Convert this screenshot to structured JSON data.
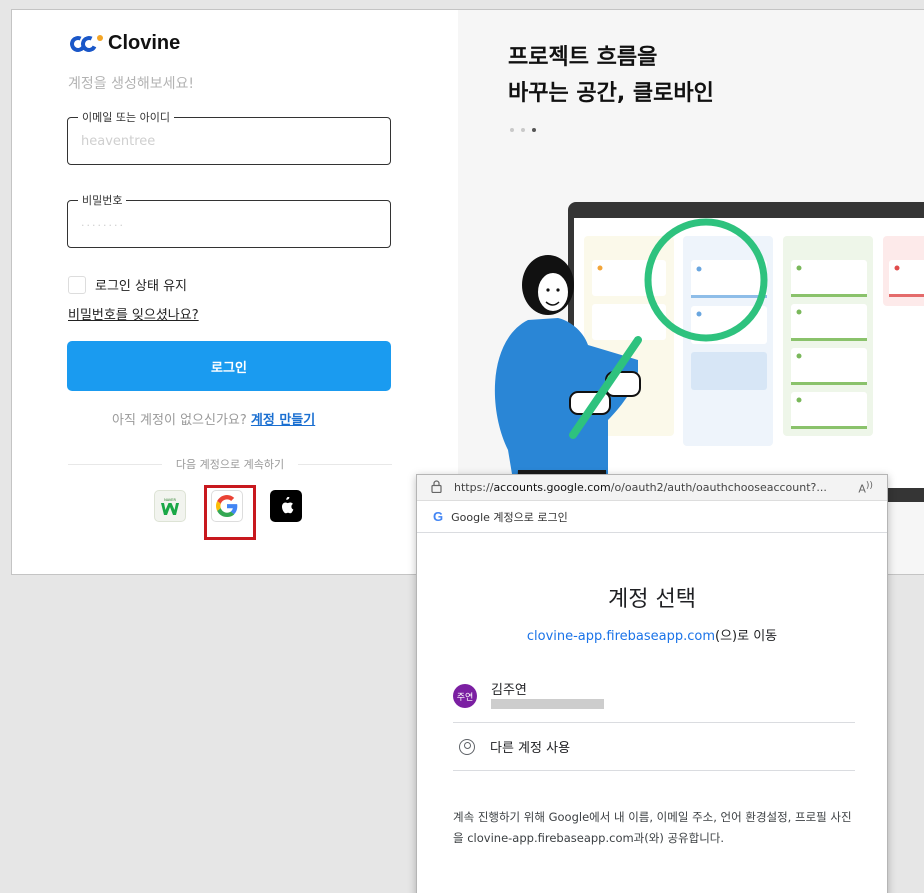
{
  "brand": {
    "name": "Clovine"
  },
  "login": {
    "subtitle": "계정을 생성해보세요!",
    "email": {
      "label": "이메일 또는 아이디",
      "value": "heaventree"
    },
    "password": {
      "label": "비밀번호",
      "value": "········"
    },
    "keep_signed_in": "로그인 상태 유지",
    "forgot_password": "비밀번호를 잊으셨나요?",
    "login_button": "로그인",
    "no_account": "아직 계정이 없으신가요?",
    "signup_link": "계정 만들기",
    "continue_with": "다음 계정으로 계속하기",
    "social": [
      "naver",
      "google",
      "apple"
    ]
  },
  "hero": {
    "line1": "프로젝트 흐름을",
    "line2": "바꾸는 공간, 클로바인"
  },
  "popup": {
    "url_prefix": "https://",
    "url_domain": "accounts.google.com",
    "url_path": "/o/oauth2/auth/oauthchooseaccount?...",
    "header": "Google 계정으로 로그인",
    "title": "계정 선택",
    "redirect_domain": "clovine-app.firebaseapp.com",
    "redirect_suffix": "(으)로 이동",
    "account": {
      "avatar": "주연",
      "name": "김주연"
    },
    "other_account": "다른 계정 사용",
    "disclaimer": "계속 진행하기 위해 Google에서 내 이름, 이메일 주소, 언어 환경설정, 프로필 사진을 clovine-app.firebaseapp.com과(와) 공유합니다."
  },
  "colors": {
    "primary": "#1a9bf0",
    "link": "#1a6fd1",
    "highlight": "#c8181e",
    "magnifier": "#2ec27e",
    "google_blue": "#1a73e8"
  }
}
